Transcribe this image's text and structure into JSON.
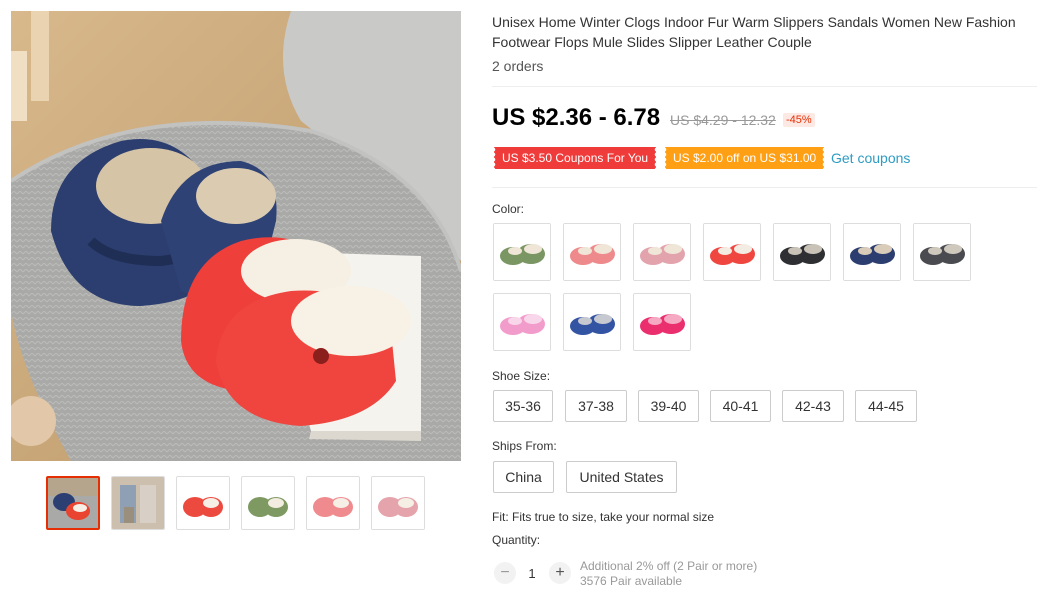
{
  "product": {
    "title": "Unisex Home Winter Clogs Indoor Fur Warm Slippers Sandals Women New Fashion Footwear Flops Mule Slides Slipper Leather Couple",
    "orders": "2 orders",
    "price": "US $2.36 - 6.78",
    "original_price": "US $4.29 - 12.32",
    "discount": "-45%"
  },
  "coupons": {
    "coupon1": "US $3.50 Coupons For You",
    "coupon2": "US $2.00 off on US $31.00",
    "get_coupons": "Get coupons"
  },
  "gallery": {
    "main_image": "product-photo",
    "thumbnails": [
      {
        "color": "#e8442f",
        "accent": "#2b3f73"
      },
      {
        "color": "#8fa0b4",
        "accent": "#d8d0c6"
      },
      {
        "color": "#ec4a3f",
        "accent": "#f5efe6"
      },
      {
        "color": "#7e9a62",
        "accent": "#f3ece0"
      },
      {
        "color": "#ef8b8e",
        "accent": "#f5efe6"
      },
      {
        "color": "#e5a3ab",
        "accent": "#f5efe6"
      }
    ]
  },
  "color": {
    "label": "Color:",
    "swatches": [
      {
        "color": "#7a9663",
        "lining": "#efe6d8"
      },
      {
        "color": "#ee8a8b",
        "lining": "#efe6d8"
      },
      {
        "color": "#e2a3ad",
        "lining": "#efe6d8"
      },
      {
        "color": "#ef4640",
        "lining": "#f3ece2"
      },
      {
        "color": "#2e2f33",
        "lining": "#c9c2b7"
      },
      {
        "color": "#2c3e6f",
        "lining": "#d9cdb9"
      },
      {
        "color": "#4a4b50",
        "lining": "#cfc8bd"
      },
      {
        "color": "#f29ccc",
        "lining": "#f7d7e9"
      },
      {
        "color": "#3353a3",
        "lining": "#c7c9d1"
      },
      {
        "color": "#ea2e6e",
        "lining": "#f5a9c3"
      }
    ]
  },
  "shoe_size": {
    "label": "Shoe Size:",
    "options": [
      "35-36",
      "37-38",
      "39-40",
      "40-41",
      "42-43",
      "44-45"
    ]
  },
  "ships_from": {
    "label": "Ships From:",
    "options": [
      "China",
      "United States"
    ]
  },
  "fit": "Fit: Fits true to size, take your normal size",
  "quantity": {
    "label": "Quantity:",
    "minus": "−",
    "value": "1",
    "plus": "+",
    "note1": "Additional 2% off (2 Pair or more)",
    "note2": "3576 Pair available"
  },
  "colors": {
    "price_accent": "#e62e04",
    "coupon_red": "#f03b3b",
    "coupon_orange": "#ff9f14",
    "link": "#2e9cc3"
  }
}
